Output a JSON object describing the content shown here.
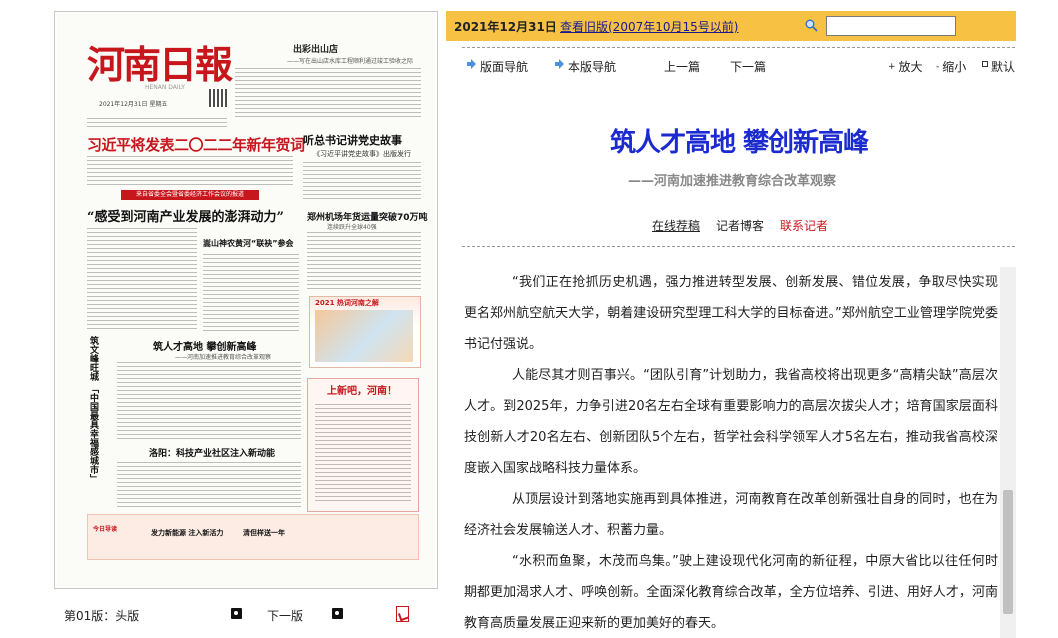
{
  "paper": {
    "masthead": "河南日報",
    "masthead_en": "HENAN DAILY",
    "date_line": "2021年12月31日 星期五",
    "top_right_title": "出彩出山店",
    "top_right_sub": "——写在出山店水库工程顺利通过竣工验收之际",
    "headline_red": "习近平将发表二〇二二年新年贺词",
    "headline_right": "听总书记讲党史故事",
    "headline_right_sub": "《习近平讲党史故事》出版发行",
    "banner": "来自省委全会暨省委经济工作会议的报道",
    "headline_big": "“感受到河南产业发展的澎湃动力”",
    "headline_mid_right": "郑州机场年货运量突破70万吨",
    "headline_mid_right_sub": "连续跃升全球40强",
    "headline_small": "嵩山神农黄河“联袂”参会",
    "box_2021_title": "2021 热词河南之解",
    "vertical_headline": "筑文峰旺城 「中国最具幸福感城市」",
    "headline_center": "筑人才高地  攀创新高峰",
    "headline_center_sub": "——河南加速推进教育综合改革观察",
    "box_new_title": "上新吧，河南！",
    "headline_luoyang": "洛阳：科技产业社区注入新动能",
    "ad_1": "发力新能源  注入新活力",
    "ad_2": "清但样送一年",
    "ad_3": "今日导读"
  },
  "footer": {
    "page_label": "第01版：头版",
    "next_page": "下一版"
  },
  "top_bar": {
    "date": "2021年12月31日",
    "old_version": "查看旧版(2007年10月15号以前)",
    "search_value": ""
  },
  "nav": {
    "page_nav": "版面导航",
    "ban_nav": "本版导航",
    "prev": "上一篇",
    "next": "下一篇",
    "zoom_in": "放大",
    "zoom_out": "缩小",
    "default": "默认"
  },
  "article": {
    "title": "筑人才高地  攀创新高峰",
    "subtitle": "——河南加速推进教育综合改革观察",
    "online_rec": "在线荐稿",
    "reporter_blog": "记者博客",
    "contact_reporter": "联系记者",
    "paragraphs": [
      "“我们正在抢抓历史机遇，强力推进转型发展、创新发展、错位发展，争取尽快实现更名郑州航空航天大学，朝着建设研究型理工科大学的目标奋进。”郑州航空工业管理学院党委书记付强说。",
      "人能尽其才则百事兴。“团队引育”计划助力，我省高校将出现更多“高精尖缺”高层次人才。到2025年，力争引进20名左右全球有重要影响力的高层次拔尖人才；培育国家层面科技创新人才20名左右、创新团队5个左右，哲学社会科学领军人才5名左右，推动我省高校深度嵌入国家战略科技力量体系。",
      "从顶层设计到落地实施再到具体推进，河南教育在改革创新强壮自身的同时，也在为经济社会发展输送人才、积蓄力量。",
      "“水积而鱼聚，木茂而鸟集。”驶上建设现代化河南的新征程，中原大省比以往任何时期都更加渴求人才、呼唤创新。全面深化教育综合改革，全方位培养、引进、用好人才，河南教育高质量发展正迎来新的更加美好的春天。"
    ]
  },
  "colors": {
    "accent_bar": "#f7c244",
    "title_blue": "#1c2bd0",
    "brand_red": "#c8161d"
  },
  "icons": [
    "search-icon",
    "nav-arrow-icon",
    "page-prev-icon",
    "page-next-icon",
    "pdf-icon"
  ]
}
